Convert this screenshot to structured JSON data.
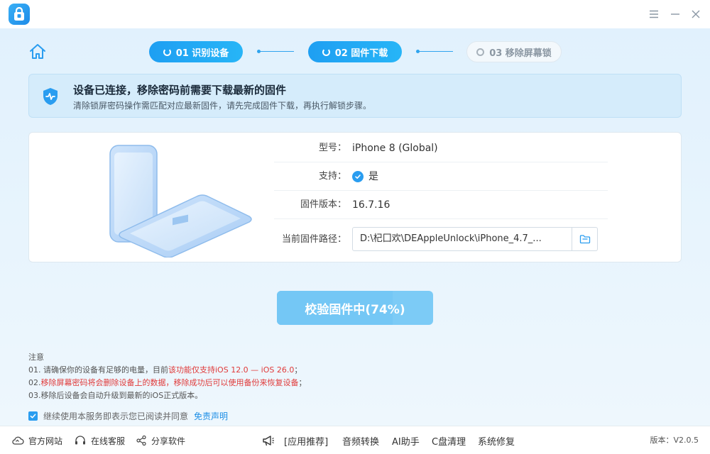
{
  "window": {
    "minimize_icon": "minimize-icon",
    "menu_icon": "menu-icon",
    "close_icon": "close-icon"
  },
  "steps": [
    {
      "label": "01 识别设备",
      "state": "active"
    },
    {
      "label": "02 固件下载",
      "state": "active"
    },
    {
      "label": "03 移除屏幕锁",
      "state": "inactive"
    }
  ],
  "notice": {
    "title": "设备已连接，移除密码前需要下载最新的固件",
    "subtitle": "清除锁屏密码操作需匹配对应最新固件，请先完成固件下载，再执行解锁步骤。"
  },
  "device": {
    "model_label": "型号：",
    "model_value": "iPhone 8 (Global)",
    "support_label": "支持：",
    "support_value": "是",
    "firmware_version_label": "固件版本：",
    "firmware_version_value": "16.7.16",
    "firmware_path_label": "当前固件路径：",
    "firmware_path_value": "D:\\杞囗欢\\DEAppleUnlock\\iPhone_4.7_..."
  },
  "progress": {
    "label": "校验固件中(74%)",
    "percent": 74
  },
  "notes": {
    "title": "注意",
    "line1_prefix": "01. 请确保你的设备有足够的电量，目前",
    "line1_highlight": "该功能仅支持iOS 12.0 — iOS 26.0",
    "line1_suffix": "；",
    "line2_prefix": "02.",
    "line2_highlight": "移除屏幕密码将会删除设备上的数据，移除成功后可以使用备份来恢复设备",
    "line2_suffix": "；",
    "line3": "03.移除后设备会自动升级到最新的iOS正式版本。"
  },
  "agreement": {
    "checked": true,
    "text": "继续使用本服务即表示您已阅读并同意",
    "link": "免责声明"
  },
  "footer": {
    "website": "官方网站",
    "support": "在线客服",
    "share": "分享软件",
    "recommend": "[应用推荐]",
    "audio": "音频转换",
    "ai": "AI助手",
    "cclean": "C盘清理",
    "repair": "系统修复",
    "version": "版本：V2.0.5"
  },
  "colors": {
    "accent": "#1e9ff2",
    "warning": "#e03a3a",
    "button": "#7ccbf6"
  }
}
